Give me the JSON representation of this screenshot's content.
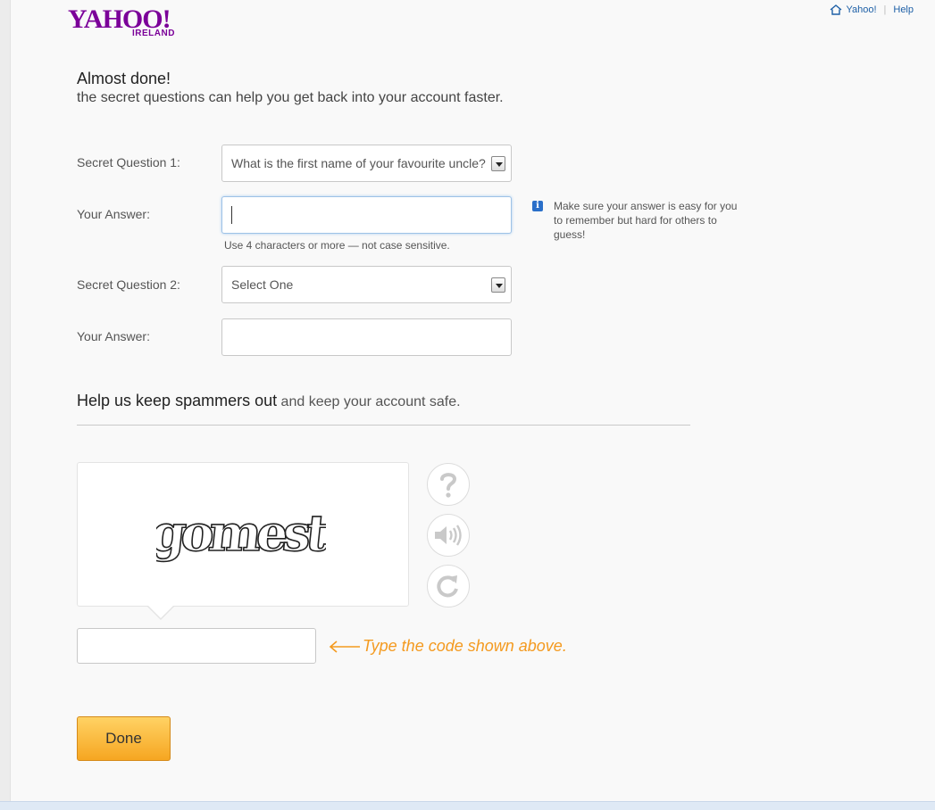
{
  "header": {
    "logo_text": "YAHOO!",
    "logo_sub": "IRELAND",
    "links": {
      "home_label": "Yahoo!",
      "help_label": "Help"
    }
  },
  "intro": {
    "title": "Almost done!",
    "subtitle": "the secret questions can help you get back into your account faster."
  },
  "form": {
    "q1_label": "Secret Question 1:",
    "q1_value": "What is the first name of your favourite uncle?",
    "a1_label": "Your Answer:",
    "a1_hint": "Use 4 characters or more — not case sensitive.",
    "tip": "Make sure your answer is easy for you to remember but hard for others to guess!",
    "q2_label": "Secret Question 2:",
    "q2_value": "Select One",
    "a2_label": "Your Answer:"
  },
  "captcha": {
    "heading_strong": "Help us keep spammers out",
    "heading_rest": " and keep your account safe.",
    "code_text": "gomest",
    "code_hint": "Type the code shown above.",
    "buttons": [
      "help-icon",
      "audio-icon",
      "refresh-icon"
    ]
  },
  "actions": {
    "done_label": "Done"
  },
  "colors": {
    "brand": "#7b0099",
    "accent": "#f49a1f",
    "link": "#1d5fa6"
  }
}
